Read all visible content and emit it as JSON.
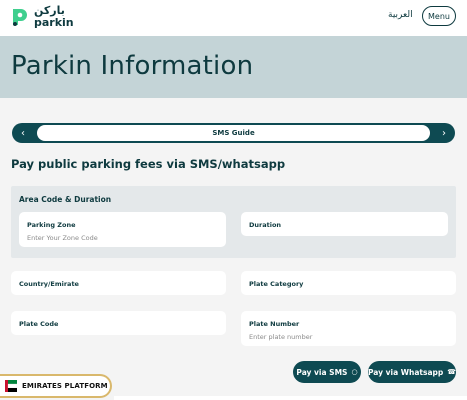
{
  "header": {
    "logo_ar": "باركن",
    "logo_en": "parkin",
    "lang_link": "العربية",
    "menu_label": "Menu"
  },
  "banner": {
    "title": "Parkin Information"
  },
  "guide": {
    "label": "SMS Guide",
    "prev_icon": "chevron-left-icon",
    "next_icon": "chevron-right-icon"
  },
  "section": {
    "heading": "Pay public parking fees via SMS/whatsapp"
  },
  "form": {
    "area_title": "Area Code & Duration",
    "parking_zone_label": "Parking Zone",
    "parking_zone_placeholder": "Enter Your Zone Code",
    "duration_label": "Duration",
    "country_label": "Country/Emirate",
    "plate_category_label": "Plate Category",
    "plate_code_label": "Plate Code",
    "plate_number_label": "Plate Number",
    "plate_number_placeholder": "Enter plate number"
  },
  "actions": {
    "pay_sms": "Pay via SMS",
    "pay_whatsapp": "Pay via Whatsapp"
  },
  "badge": {
    "label": "EMIRATES PLATFORM"
  },
  "colors": {
    "primary": "#0e4a52",
    "banner": "#c4d4d7",
    "brand_green": "#3fcf8e",
    "badge_border": "#d9b86c"
  }
}
